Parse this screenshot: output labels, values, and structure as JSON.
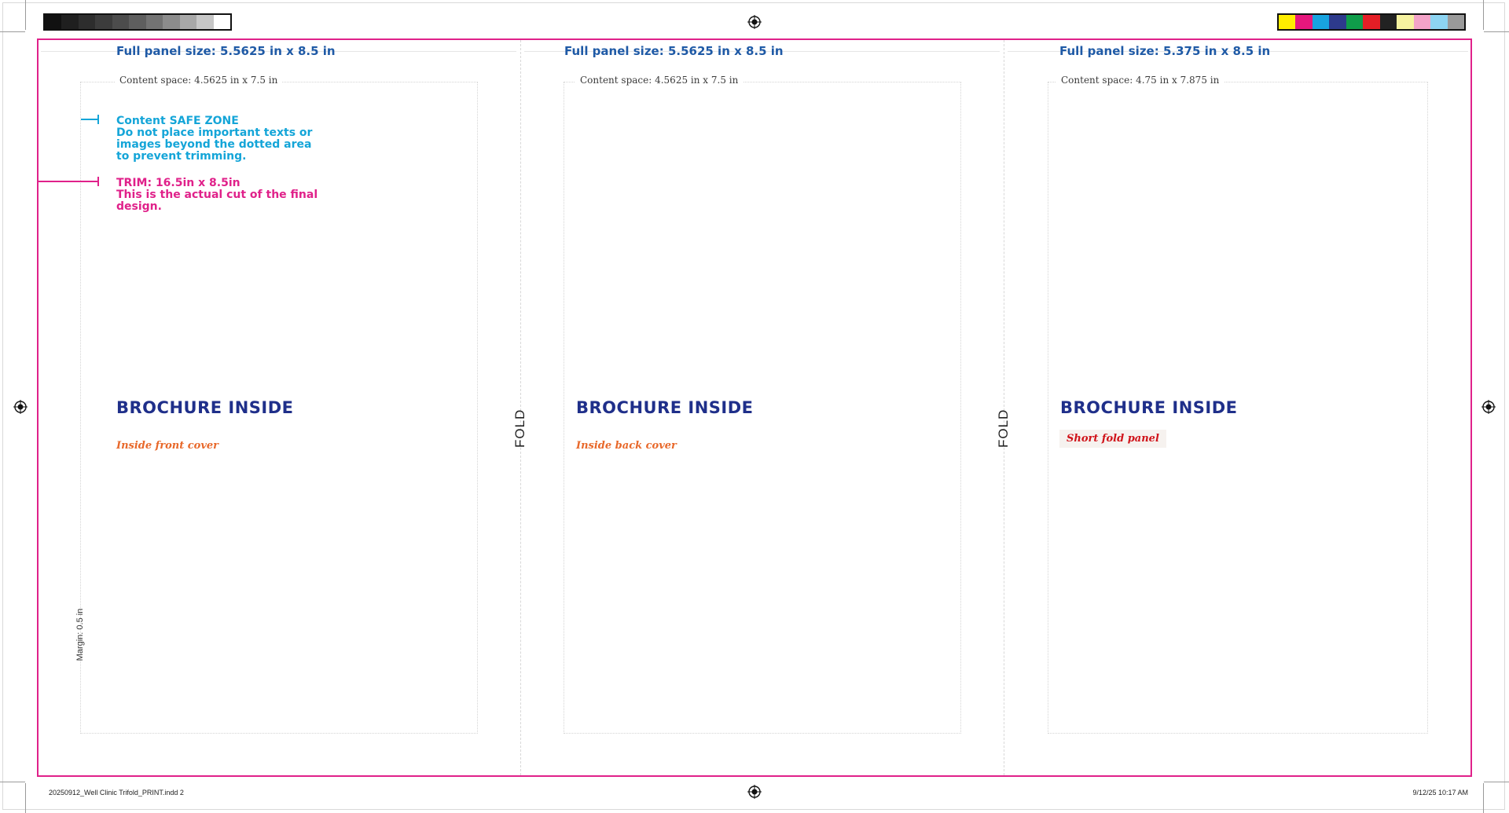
{
  "grayscale_strip": [
    "#111111",
    "#1f1f1f",
    "#2d2d2d",
    "#3c3c3c",
    "#4c4c4c",
    "#5e5e5e",
    "#737373",
    "#8c8c8c",
    "#a8a8a8",
    "#c7c7c7",
    "#ffffff"
  ],
  "color_strip": [
    "#ffee00",
    "#e6177d",
    "#18a3e0",
    "#2d3a8c",
    "#0f9d4a",
    "#e41e26",
    "#222222",
    "#f6f2a0",
    "#f3a3c8",
    "#8dd4f2",
    "#9a9a9a"
  ],
  "panels": [
    {
      "full_size": "Full panel size: 5.5625 in x 8.5 in",
      "content_space": "Content space: 4.5625 in x 7.5 in",
      "title": "BROCHURE INSIDE",
      "subtitle": "Inside front cover"
    },
    {
      "full_size": "Full panel size: 5.5625 in x 8.5 in",
      "content_space": "Content space: 4.5625 in x 7.5 in",
      "title": "BROCHURE INSIDE",
      "subtitle": "Inside back cover"
    },
    {
      "full_size": "Full panel size: 5.375 in x 8.5 in",
      "content_space": "Content space: 4.75 in x 7.875 in",
      "title": "BROCHURE INSIDE",
      "subtitle": "Short fold panel"
    }
  ],
  "fold_label": "FOLD",
  "notes": {
    "safe_line1": "Content SAFE ZONE",
    "safe_line2": "Do not place important texts or images beyond the dotted area to prevent trimming.",
    "trim_line1": "TRIM: 16.5in x 8.5in",
    "trim_line2": "This is the actual cut of the final design."
  },
  "margin_label": "Margin: 0.5 in",
  "footer": {
    "file": "20250912_Well Clinic Trifold_PRINT.indd   2",
    "timestamp": "9/12/25   10:17 AM"
  },
  "colors": {
    "trim": "#e0218a",
    "safe": "#14a5d8",
    "heading": "#1f5aa6",
    "title": "#1f2f8a",
    "subtitle": "#e8682a",
    "short_fold": "#d0131a"
  }
}
